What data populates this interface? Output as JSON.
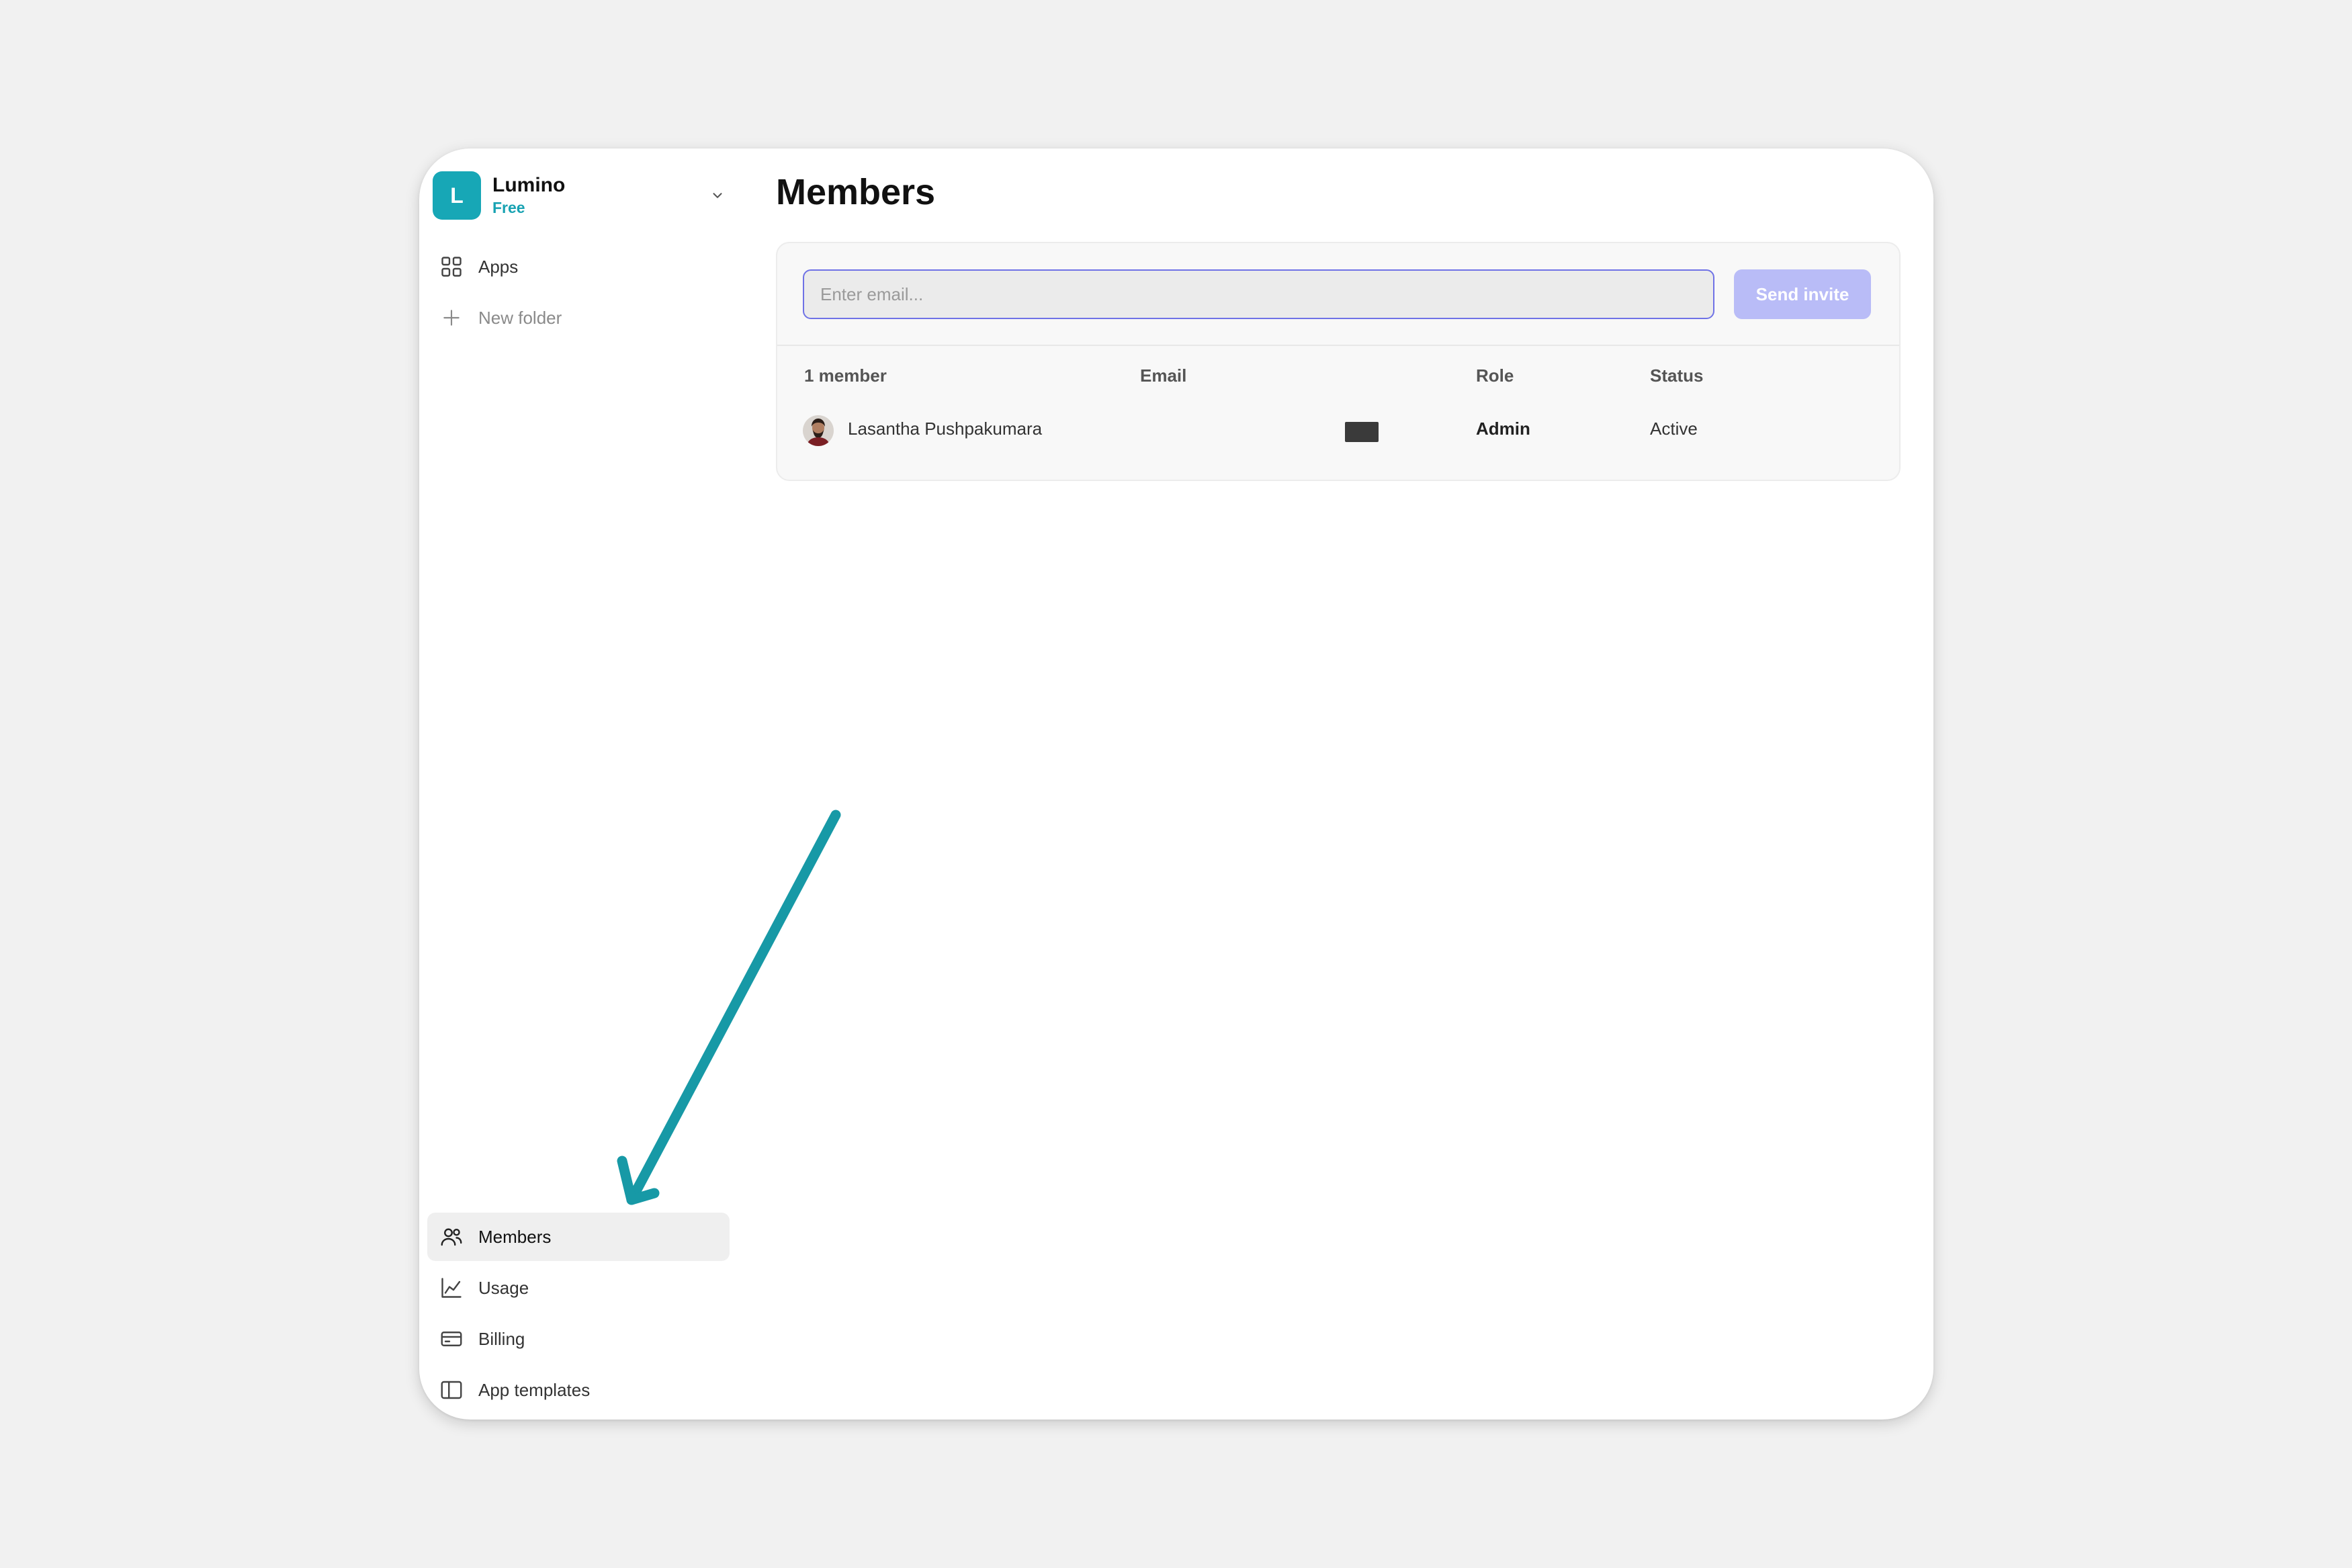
{
  "workspace": {
    "logo_letter": "L",
    "name": "Lumino",
    "plan": "Free",
    "chevron_icon": "chevron-down-icon"
  },
  "sidebar": {
    "top_items": [
      {
        "label": "Apps",
        "icon": "grid-icon"
      },
      {
        "label": "New folder",
        "icon": "plus-icon"
      }
    ],
    "bottom_items": [
      {
        "label": "Members",
        "icon": "users-icon",
        "active": true
      },
      {
        "label": "Usage",
        "icon": "chart-line-icon"
      },
      {
        "label": "Billing",
        "icon": "credit-card-icon"
      },
      {
        "label": "App templates",
        "icon": "book-open-icon"
      }
    ]
  },
  "main": {
    "title": "Members",
    "invite": {
      "placeholder": "Enter email...",
      "value": "",
      "button_label": "Send invite"
    },
    "table": {
      "headers": {
        "member": "1 member",
        "email": "Email",
        "role": "Role",
        "status": "Status"
      },
      "rows": [
        {
          "name": "Lasantha Pushpakumara",
          "email": "",
          "role": "Admin",
          "status": "Active"
        }
      ]
    }
  },
  "colors": {
    "accent": "#17a7b6",
    "input_border": "#6f72e6",
    "button_bg": "#b9bcf7",
    "annotation_arrow": "#1799a6"
  }
}
